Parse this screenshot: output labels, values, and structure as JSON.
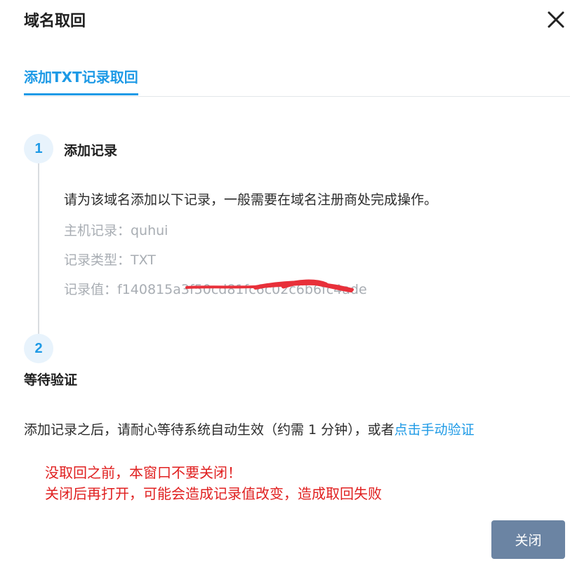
{
  "dialog": {
    "title": "域名取回",
    "close_icon": "close-icon"
  },
  "tab": {
    "label": "添加TXT记录取回"
  },
  "step1": {
    "number": "1",
    "title": "添加记录",
    "description": "请为该域名添加以下记录，一般需要在域名注册商处完成操作。",
    "host_record": "主机记录：quhui",
    "record_type": "记录类型：TXT",
    "record_value": "记录值：f140815a3f50cd81fc6c02c6b6fc4ade"
  },
  "step2": {
    "number": "2",
    "title": "等待验证",
    "text": "添加记录之后，请耐心等待系统自动生效（约需 1 分钟），或者",
    "link": "点击手动验证"
  },
  "warning": {
    "line1": "没取回之前，本窗口不要关闭！",
    "line2": "关闭后再打开，可能会造成记录值改变，造成取回失败"
  },
  "footer": {
    "close_button": "关闭"
  },
  "colors": {
    "accent": "#1e9ae6",
    "warning": "#e02020",
    "button": "#6b84a3",
    "redaction": "#e8303a"
  }
}
